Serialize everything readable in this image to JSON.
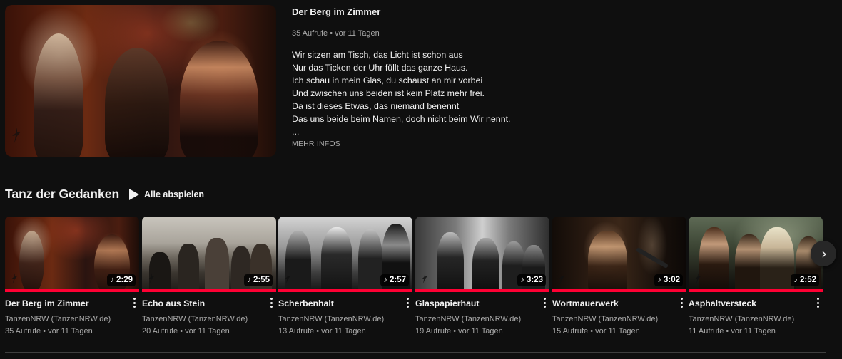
{
  "featured": {
    "title": "Der Berg im Zimmer",
    "views": "35 Aufrufe",
    "age": "vor 11 Tagen",
    "lyrics": [
      "Wir sitzen am Tisch, das Licht ist schon aus",
      "Nur das Ticken der Uhr füllt das ganze Haus.",
      "Ich schau in mein Glas, du schaust an mir vorbei",
      "Und zwischen uns beiden ist kein Platz mehr frei.",
      "Da ist dieses Etwas, das niemand benennt",
      "Das uns beide beim Namen, doch nicht beim Wir nennt.",
      "..."
    ],
    "more_label": "MEHR INFOS"
  },
  "playlist": {
    "title": "Tanz der Gedanken",
    "play_all_label": "Alle abspielen",
    "separator": "•",
    "videos": [
      {
        "title": "Der Berg im Zimmer",
        "duration": "2:29",
        "channel": "TanzenNRW (TanzenNRW.de)",
        "views": "35 Aufrufe",
        "age": "vor 11 Tagen"
      },
      {
        "title": "Echo aus Stein",
        "duration": "2:55",
        "channel": "TanzenNRW (TanzenNRW.de)",
        "views": "20 Aufrufe",
        "age": "vor 11 Tagen"
      },
      {
        "title": "Scherbenhalt",
        "duration": "2:57",
        "channel": "TanzenNRW (TanzenNRW.de)",
        "views": "13 Aufrufe",
        "age": "vor 11 Tagen"
      },
      {
        "title": "Glaspapierhaut",
        "duration": "3:23",
        "channel": "TanzenNRW (TanzenNRW.de)",
        "views": "19 Aufrufe",
        "age": "vor 11 Tagen"
      },
      {
        "title": "Wortmauerwerk",
        "duration": "3:02",
        "channel": "TanzenNRW (TanzenNRW.de)",
        "views": "15 Aufrufe",
        "age": "vor 11 Tagen"
      },
      {
        "title": "Asphaltversteck",
        "duration": "2:52",
        "channel": "TanzenNRW (TanzenNRW.de)",
        "views": "11 Aufrufe",
        "age": "vor 11 Tagen"
      }
    ]
  },
  "icons": {
    "play_all": "play-triangle-icon",
    "duration_badge": "music-note-icon",
    "menu": "vertical-ellipsis-icon",
    "next": "chevron-right-icon"
  },
  "colors": {
    "background": "#0f0f0f",
    "progress": "#ff0033",
    "secondary_text": "#aaaaaa"
  }
}
